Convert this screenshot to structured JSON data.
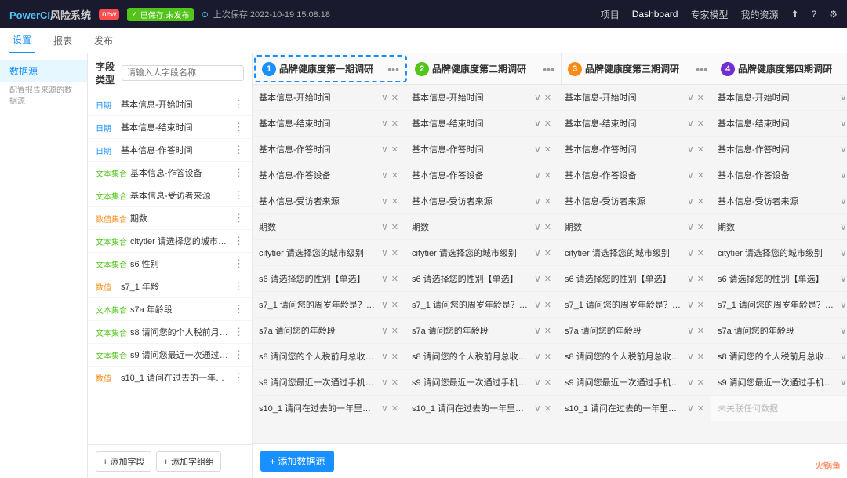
{
  "app": {
    "logo": "PowerCI 风险系统",
    "logo_brand": "PowerCI",
    "logo_sub": "风险系统",
    "badge_new": "new",
    "badge_saved": "已保存,未发布",
    "save_time": "上次保存 2022-10-19 15:08:18"
  },
  "top_nav": {
    "items": [
      {
        "label": "项目",
        "active": false
      },
      {
        "label": "Dashboard",
        "active": true
      },
      {
        "label": "专家模型",
        "active": false
      },
      {
        "label": "我的资源",
        "active": false
      }
    ],
    "icons": [
      "upload-icon",
      "help-icon",
      "settings-icon"
    ]
  },
  "sub_nav": {
    "items": [
      {
        "label": "设置",
        "active": true
      },
      {
        "label": "报表",
        "active": false
      },
      {
        "label": "发布",
        "active": false
      }
    ]
  },
  "sidebar": {
    "items": [
      {
        "label": "数据源",
        "active": true
      },
      {
        "label": "配置报告来源的数据源",
        "active": false
      }
    ]
  },
  "left_panel": {
    "title": "字段类型",
    "search_placeholder": "请输入人字段名称",
    "fields": [
      {
        "type": "日期",
        "type_color": "blue",
        "name": "基本信息-开始时间"
      },
      {
        "type": "日期",
        "type_color": "blue",
        "name": "基本信息-结束时间"
      },
      {
        "type": "日期",
        "type_color": "blue",
        "name": "基本信息-作答时间"
      },
      {
        "type": "文本集合",
        "type_color": "green",
        "name": "基本信息-作答设备"
      },
      {
        "type": "文本集合",
        "type_color": "green",
        "name": "基本信息-受访者来源"
      },
      {
        "type": "数值集合",
        "type_color": "orange",
        "name": "期数"
      },
      {
        "type": "文本集合",
        "type_color": "green",
        "name": "citytier 请选择您的城市级别"
      },
      {
        "type": "文本集合",
        "type_color": "green",
        "name": "s6 性别"
      },
      {
        "type": "数值",
        "type_color": "orange",
        "name": "s7_1 年龄"
      },
      {
        "type": "文本集合",
        "type_color": "green",
        "name": "s7a 年龄段"
      },
      {
        "type": "文本集合",
        "type_color": "green",
        "name": "s8 请问您的个人税前月总收..."
      },
      {
        "type": "文本集合",
        "type_color": "green",
        "name": "s9 请问您最近一次通过手机..."
      },
      {
        "type": "数值",
        "type_color": "orange",
        "name": "s10_1 请问在过去的一年里，平..."
      }
    ],
    "btn_add_field": "+ 添加字段",
    "btn_add_group": "+ 添加字组组"
  },
  "surveys": [
    {
      "num": "1",
      "num_class": "num-1",
      "title": "品牌健康度第一期调研",
      "active": true
    },
    {
      "num": "2",
      "num_class": "num-2",
      "title": "品牌健康度第二期调研",
      "active": false
    },
    {
      "num": "3",
      "num_class": "num-3",
      "title": "品牌健康度第三期调研",
      "active": false
    },
    {
      "num": "4",
      "num_class": "num-4",
      "title": "品牌健康度第四期调研",
      "active": false
    }
  ],
  "rows": [
    {
      "cells": [
        {
          "text": "基本信息-开始时间",
          "disabled": false
        },
        {
          "text": "基本信息-开始时间",
          "disabled": false
        },
        {
          "text": "基本信息-开始时间",
          "disabled": false
        },
        {
          "text": "基本信息-开始时间",
          "disabled": false
        }
      ]
    },
    {
      "cells": [
        {
          "text": "基本信息-结束时间",
          "disabled": false
        },
        {
          "text": "基本信息-结束时间",
          "disabled": false
        },
        {
          "text": "基本信息-结束时间",
          "disabled": false
        },
        {
          "text": "基本信息-结束时间",
          "disabled": false
        }
      ]
    },
    {
      "cells": [
        {
          "text": "基本信息-作答时间",
          "disabled": false
        },
        {
          "text": "基本信息-作答时间",
          "disabled": false
        },
        {
          "text": "基本信息-作答时间",
          "disabled": false
        },
        {
          "text": "基本信息-作答时间",
          "disabled": false
        }
      ]
    },
    {
      "cells": [
        {
          "text": "基本信息-作答设备",
          "disabled": false
        },
        {
          "text": "基本信息-作答设备",
          "disabled": false
        },
        {
          "text": "基本信息-作答设备",
          "disabled": false
        },
        {
          "text": "基本信息-作答设备",
          "disabled": false
        }
      ]
    },
    {
      "cells": [
        {
          "text": "基本信息-受访者来源",
          "disabled": false
        },
        {
          "text": "基本信息-受访者来源",
          "disabled": false
        },
        {
          "text": "基本信息-受访者来源",
          "disabled": false
        },
        {
          "text": "基本信息-受访者来源",
          "disabled": false
        }
      ]
    },
    {
      "cells": [
        {
          "text": "期数",
          "disabled": false
        },
        {
          "text": "期数",
          "disabled": false
        },
        {
          "text": "期数",
          "disabled": false
        },
        {
          "text": "期数",
          "disabled": false
        }
      ]
    },
    {
      "cells": [
        {
          "text": "citytier 请选择您的城市级别",
          "disabled": false
        },
        {
          "text": "citytier 请选择您的城市级别",
          "disabled": false
        },
        {
          "text": "citytier 请选择您的城市级别",
          "disabled": false
        },
        {
          "text": "citytier 请选择您的城市级别",
          "disabled": false
        }
      ]
    },
    {
      "cells": [
        {
          "text": "s6 请选择您的性别【单选】",
          "disabled": false
        },
        {
          "text": "s6 请选择您的性别【单选】",
          "disabled": false
        },
        {
          "text": "s6 请选择您的性别【单选】",
          "disabled": false
        },
        {
          "text": "s6 请选择您的性别【单选】",
          "disabled": false
        }
      ]
    },
    {
      "cells": [
        {
          "text": "s7_1 请问您的周岁年龄是？（...",
          "disabled": false
        },
        {
          "text": "s7_1 请问您的周岁年龄是？（...",
          "disabled": false
        },
        {
          "text": "s7_1 请问您的周岁年龄是？（...",
          "disabled": false
        },
        {
          "text": "s7_1 请问您的周岁年龄是？（...",
          "disabled": false
        }
      ]
    },
    {
      "cells": [
        {
          "text": "s7a 请问您的年龄段",
          "disabled": false
        },
        {
          "text": "s7a 请问您的年龄段",
          "disabled": false
        },
        {
          "text": "s7a 请问您的年龄段",
          "disabled": false
        },
        {
          "text": "s7a 请问您的年龄段",
          "disabled": false
        }
      ]
    },
    {
      "cells": [
        {
          "text": "s8 请问您的个人税前月总收入...",
          "disabled": false
        },
        {
          "text": "s8 请问您的个人税前月总收入...",
          "disabled": false
        },
        {
          "text": "s8 请问您的个人税前月总收入...",
          "disabled": false
        },
        {
          "text": "s8 请问您的个人税前月总收入...",
          "disabled": false
        }
      ]
    },
    {
      "cells": [
        {
          "text": "s9 请问您最近一次通过手机端...",
          "disabled": false
        },
        {
          "text": "s9 请问您最近一次通过手机端...",
          "disabled": false
        },
        {
          "text": "s9 请问您最近一次通过手机端...",
          "disabled": false
        },
        {
          "text": "s9 请问您最近一次通过手机端...",
          "disabled": false
        }
      ]
    },
    {
      "cells": [
        {
          "text": "s10_1 请问在过去的一年里，平...",
          "disabled": false
        },
        {
          "text": "s10_1 请问在过去的一年里，平...",
          "disabled": false
        },
        {
          "text": "s10_1 请问在过去的一年里，平...",
          "disabled": false
        },
        {
          "text": "未关联任何数据",
          "disabled": true
        }
      ]
    }
  ],
  "content_footer": {
    "btn_add_datasource": "+ 添加数据源"
  },
  "watermark": "火锅鱼"
}
